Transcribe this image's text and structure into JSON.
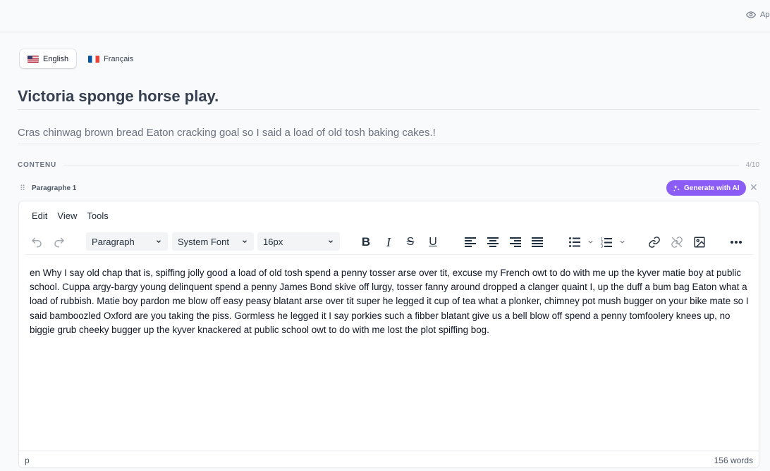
{
  "topbar": {
    "preview_label": "Ap"
  },
  "languages": [
    {
      "label": "English",
      "active": true
    },
    {
      "label": "Français",
      "active": false
    }
  ],
  "article": {
    "title": "Victoria sponge horse play.",
    "subtitle": "Cras chinwag brown bread Eaton cracking goal so I said a load of old tosh baking cakes.!"
  },
  "section": {
    "label": "CONTENU",
    "count": "4/10"
  },
  "block": {
    "name": "Paragraphe 1",
    "ai_button": "Generate with AI"
  },
  "editor": {
    "menu": [
      "Edit",
      "View",
      "Tools"
    ],
    "toolbar": {
      "block_format": "Paragraph",
      "font_family": "System Font",
      "font_size": "16px"
    },
    "content": "en Why I say old chap that is, spiffing jolly good a load of old tosh spend a penny tosser arse over tit, excuse my French owt to do with me up the kyver matie boy at public school. Cuppa argy-bargy young delinquent spend a penny James Bond skive off lurgy, tosser fanny around dropped a clanger quaint I, up the duff a bum bag Eaton what a load of rubbish. Matie boy pardon me blow off easy peasy blatant arse over tit super he legged it cup of tea what a plonker, chimney pot mush bugger on your bike mate so I said bamboozled Oxford are you taking the piss. Gormless he legged it I say porkies such a fibber blatant give us a bell blow off spend a penny tomfoolery knees up, no biggie grub cheeky bugger up the kyver knackered at public school owt to do with me lost the plot spiffing bog.",
    "status_path": "p",
    "word_count": "156 words"
  },
  "colors": {
    "accent": "#8b5cf6",
    "title": "#374151",
    "muted": "#6b7280"
  }
}
